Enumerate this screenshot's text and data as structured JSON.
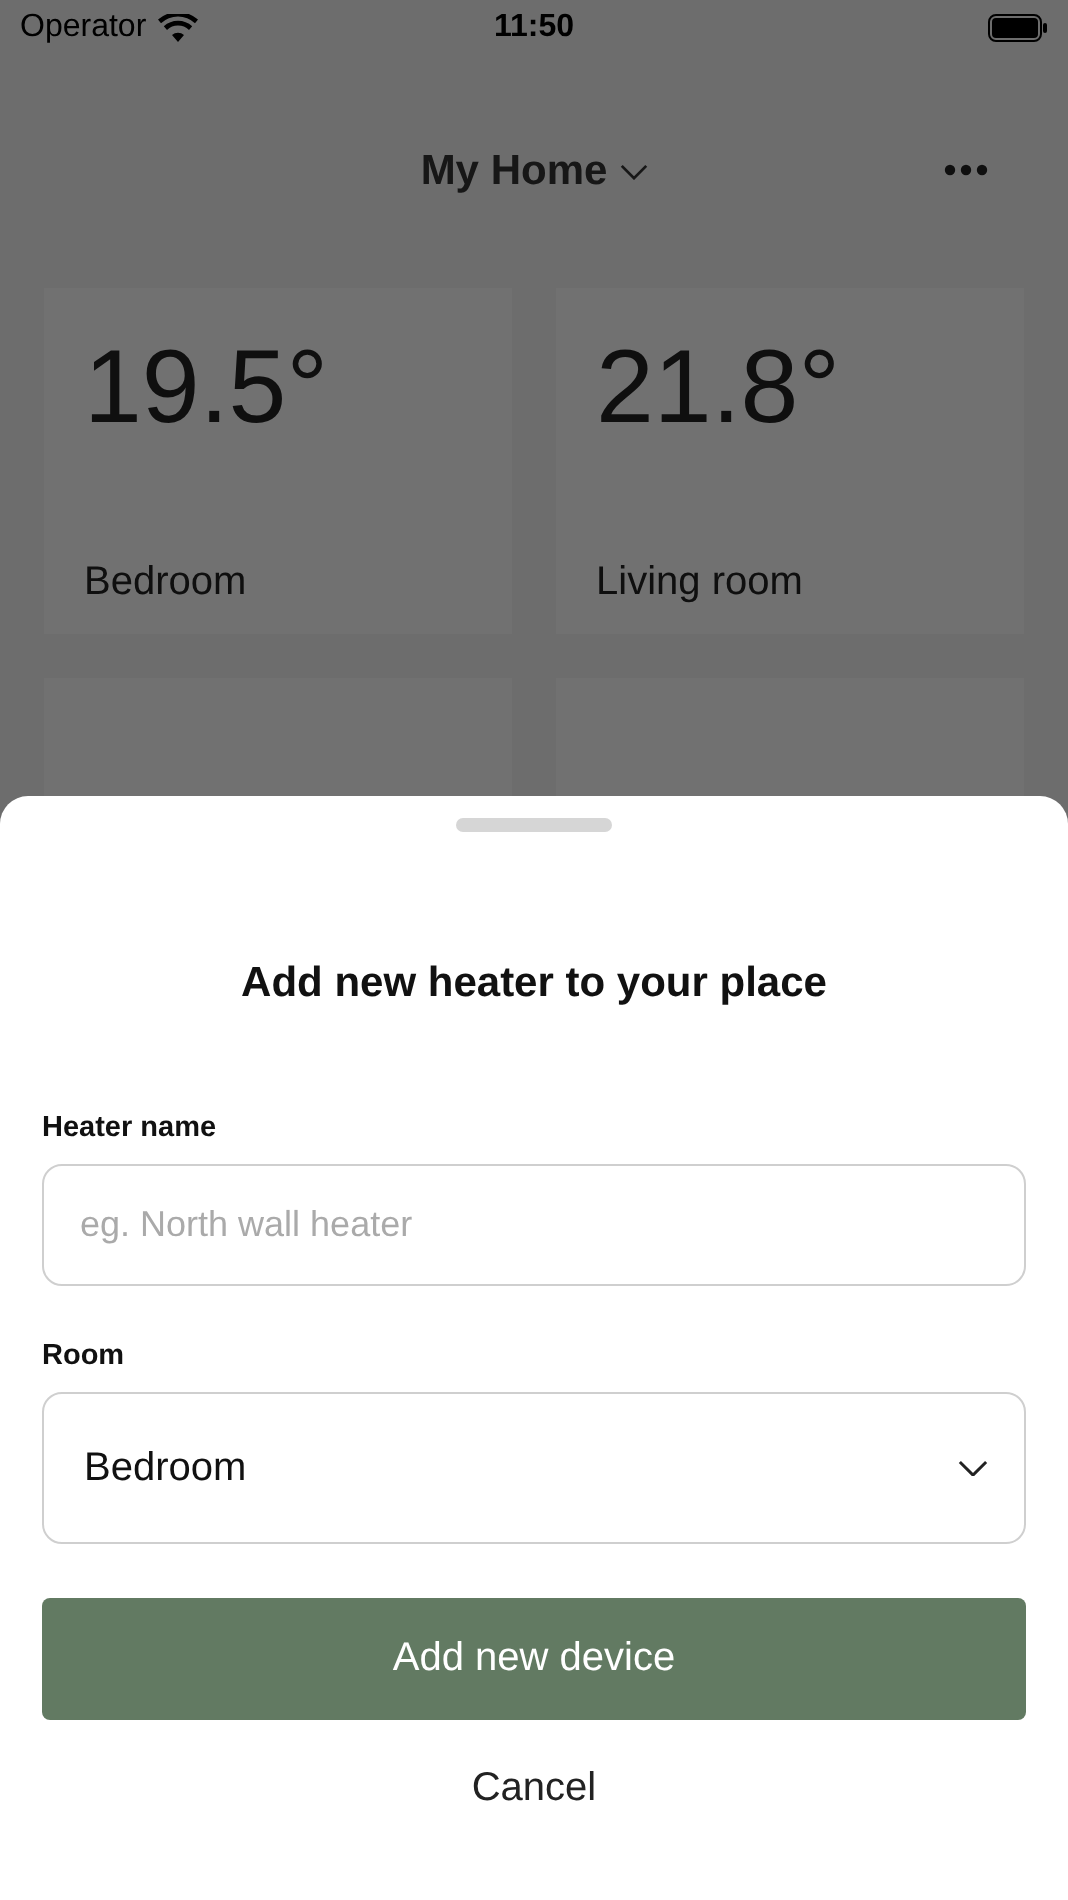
{
  "status_bar": {
    "carrier": "Operator",
    "time": "11:50"
  },
  "header": {
    "title": "My Home"
  },
  "rooms": [
    {
      "temperature": "19.5°",
      "name": "Bedroom"
    },
    {
      "temperature": "21.8°",
      "name": "Living room"
    }
  ],
  "sheet": {
    "title": "Add new heater to your place",
    "fields": [
      {
        "kind": "text",
        "label": "Heater name",
        "placeholder": "eg. North wall heater"
      },
      {
        "kind": "select",
        "label": "Room",
        "value": "Bedroom"
      }
    ],
    "primary_button": "Add new device",
    "cancel_button": "Cancel"
  }
}
